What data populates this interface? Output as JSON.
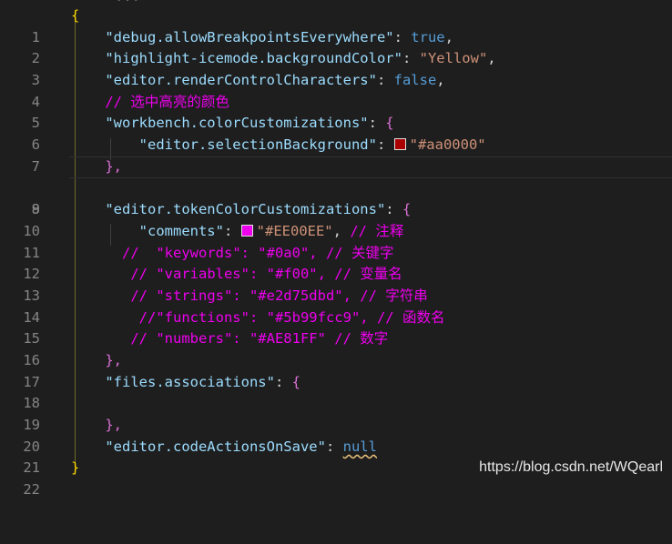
{
  "top_fragment": "...",
  "lines": [
    {
      "n": "1"
    },
    {
      "n": "2"
    },
    {
      "n": "3"
    },
    {
      "n": "4"
    },
    {
      "n": "5"
    },
    {
      "n": "6"
    },
    {
      "n": "7"
    },
    {
      "n": "8"
    },
    {
      "n": "9"
    },
    {
      "n": "10"
    },
    {
      "n": "11"
    },
    {
      "n": "12"
    },
    {
      "n": "13"
    },
    {
      "n": "14"
    },
    {
      "n": "15"
    },
    {
      "n": "16"
    },
    {
      "n": "17"
    },
    {
      "n": "18"
    },
    {
      "n": "19"
    },
    {
      "n": "20"
    },
    {
      "n": "21"
    },
    {
      "n": "22"
    }
  ],
  "code": {
    "open_brace": "{",
    "close_brace": "}",
    "comma": ",",
    "colon": ": ",
    "k_debug": "\"debug.allowBreakpointsEverywhere\"",
    "v_debug": "true",
    "k_highlight": "\"highlight-icemode.backgroundColor\"",
    "v_highlight": "\"Yellow\"",
    "k_render": "\"editor.renderControlCharacters\"",
    "v_render": "false",
    "c_select": "// 选中高亮的颜色",
    "k_workbench": "\"workbench.colorCustomizations\"",
    "k_selbg": "\"editor.selectionBackground\"",
    "v_selbg": "\"#aa0000\"",
    "close_obj": "},",
    "k_token": "\"editor.tokenColorCustomizations\"",
    "k_comments": "\"comments\"",
    "v_comments": "\"#EE00EE\"",
    "c_comments": "// 注释",
    "c_keywords": "//  \"keywords\": \"#0a0\", // 关键字",
    "c_variables": "// \"variables\": \"#f00\", // 变量名",
    "c_strings": "// \"strings\": \"#e2d75dbd\", // 字符串",
    "c_functions": "//\"functions\": \"#5b99fcc9\", // 函数名",
    "c_numbers": "// \"numbers\": \"#AE81FF\" // 数字",
    "k_files": "\"files.associations\"",
    "k_codeactions": "\"editor.codeActionsOnSave\"",
    "v_codeactions": "null"
  },
  "swatches": {
    "selection_bg": "#aa0000",
    "comments": "#EE00EE"
  },
  "watermark": "https://blog.csdn.net/WQearl"
}
